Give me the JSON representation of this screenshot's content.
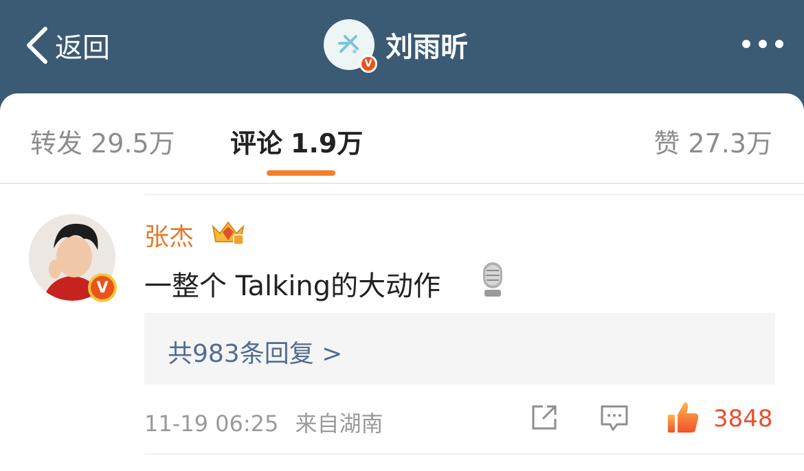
{
  "header": {
    "back_label": "返回",
    "title": "刘雨昕",
    "verified_badge": "V",
    "bg_color": "#3b5a74"
  },
  "tabs": [
    {
      "label": "转发",
      "count": "29.5万",
      "active": false
    },
    {
      "label": "评论",
      "count": "1.9万",
      "active": true
    },
    {
      "label": "赞",
      "count": "27.3万",
      "active": false
    }
  ],
  "accent_color": "#f4802b",
  "comment": {
    "author": "张杰",
    "author_color": "#e5792b",
    "verified_badge": "V",
    "text": "一整个 Talking的大动作",
    "emoji": "mic-icon",
    "replies_label": "共983条回复 >",
    "timestamp": "11-19 06:25",
    "location": "来自湖南",
    "like_count": "3848",
    "like_color": "#e8502f"
  },
  "icons": [
    "chevron-left-icon",
    "more-icon",
    "crown-badge-icon",
    "mic-icon",
    "share-icon",
    "comment-icon",
    "thumbs-up-icon"
  ]
}
